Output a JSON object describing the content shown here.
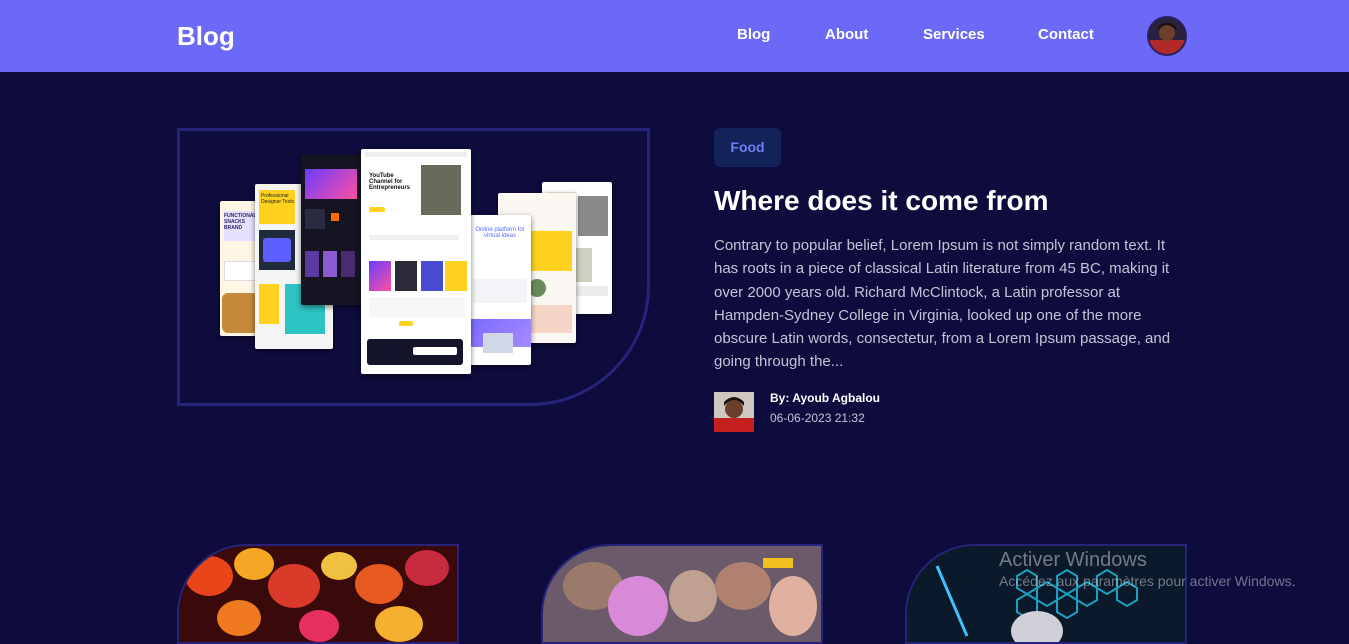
{
  "header": {
    "logo": "Blog",
    "nav": [
      "Blog",
      "About",
      "Services",
      "Contact"
    ]
  },
  "featured_post": {
    "category": "Food",
    "title": "Where does it come from",
    "excerpt": "Contrary to popular belief, Lorem Ipsum is not simply random text. It has roots in a piece of classical Latin literature from 45 BC, making it over 2000 years old. Richard McClintock, a Latin professor at Hampden-Sydney College in Virginia, looked up one of the more obscure Latin words, consectetur, from a Lorem Ipsum passage, and going through the...",
    "author": "By: Ayoub Agbalou",
    "date": "06-06-2023 21:32",
    "image_text": {
      "designer": "Professional Designer Tools",
      "youtube": "YouTube Channel for Entrepreneurs",
      "online": "Online platform for virtual ideas",
      "functional": "FUNCTIONAL SNACKS BRAND"
    }
  },
  "windows_watermark": {
    "title": "Activer Windows",
    "subtitle": "Accédez aux paramètres pour activer Windows."
  },
  "colors": {
    "navbar": "#6c69f6",
    "background": "#0e0c3d",
    "badge_bg": "#14225a",
    "badge_text": "#6c7ff8"
  }
}
